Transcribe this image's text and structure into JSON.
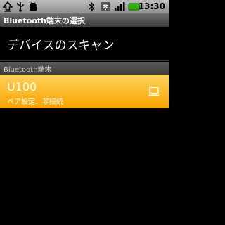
{
  "status_bar": {
    "time": "13:30",
    "icons": [
      "upload-icon",
      "usb-icon",
      "android-icon",
      "bluetooth-icon",
      "wifi-icon",
      "signal-icon",
      "battery-icon"
    ]
  },
  "title_bar": {
    "title": "Bluetooth端末の選択"
  },
  "scan": {
    "label": "デバイスのスキャン"
  },
  "category": {
    "header": "Bluetooth端末"
  },
  "devices": [
    {
      "name": "U100",
      "status": "ペア設定、非接続",
      "icon": "laptop-icon",
      "selected": true
    }
  ],
  "colors": {
    "selected_top": "#ffd35a",
    "selected_bottom": "#f6a300",
    "background": "#000000"
  }
}
